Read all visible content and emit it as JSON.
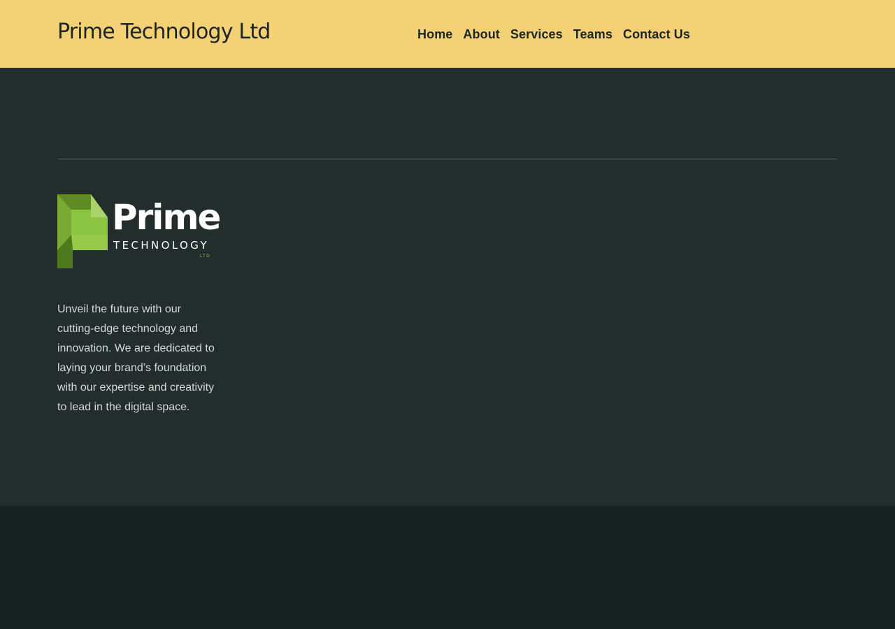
{
  "header": {
    "site_title": "Prime Technology Ltd",
    "nav": [
      {
        "label": "Home"
      },
      {
        "label": "About"
      },
      {
        "label": "Services"
      },
      {
        "label": "Teams"
      },
      {
        "label": "Contact Us"
      }
    ]
  },
  "footer": {
    "logo": {
      "word": "Prime",
      "sub": "TECHNOLOGY",
      "ltd": "LTD"
    },
    "description": "Unveil the future with our cutting-edge technology and innovation. We are dedicated to laying your brand’s foundation with our expertise and creativity to lead in the digital space."
  },
  "colors": {
    "header_bg": "#f5d175",
    "footer_top_bg": "#232e2c",
    "footer_bottom_bg": "#15221f",
    "text_dark": "#1b2621",
    "logo_green": "#8fbf3f"
  }
}
